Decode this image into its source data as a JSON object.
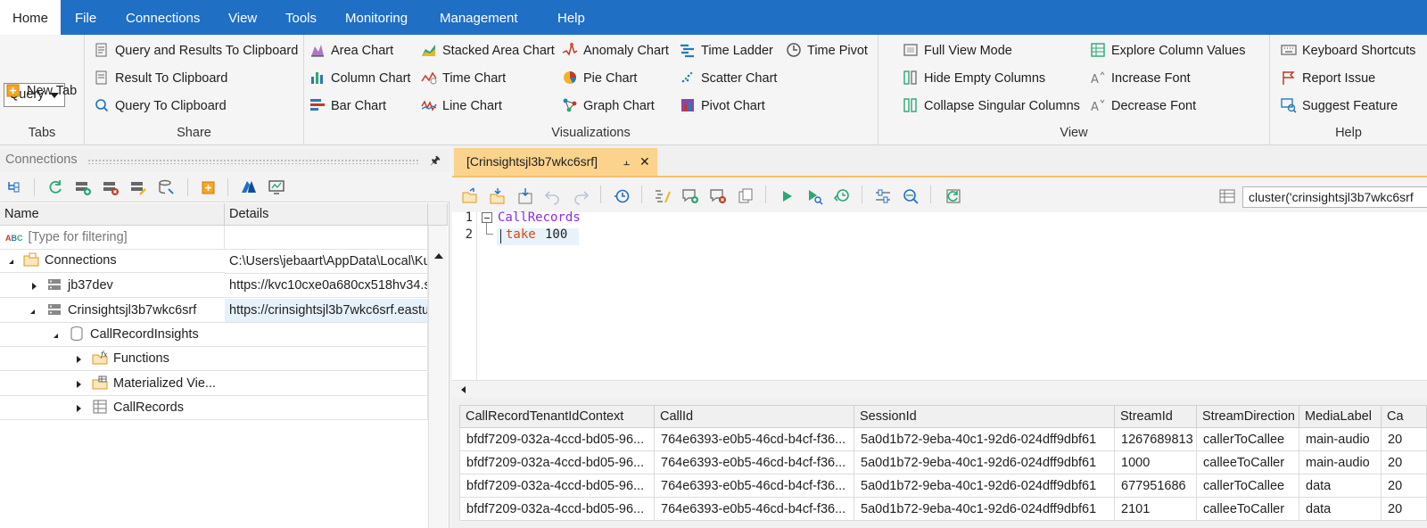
{
  "menu": {
    "items": [
      "Home",
      "File",
      "Connections",
      "View",
      "Tools",
      "Monitoring",
      "Management",
      "Help"
    ]
  },
  "ribbon": {
    "tabs_group": {
      "label": "Tabs",
      "query_combo": "Query",
      "new_tab": "New Tab"
    },
    "share_group": {
      "label": "Share",
      "items": [
        "Query and Results To Clipboard",
        "Result To Clipboard",
        "Query To Clipboard"
      ]
    },
    "viz_group": {
      "label": "Visualizations",
      "items": [
        "Area Chart",
        "Stacked Area Chart",
        "Anomaly Chart",
        "Time Ladder",
        "Time Pivot",
        "Column Chart",
        "Time Chart",
        "Pie Chart",
        "Scatter Chart",
        "Bar Chart",
        "Line Chart",
        "Graph Chart",
        "Pivot Chart"
      ]
    },
    "view_group": {
      "label": "View",
      "items": [
        "Full View Mode",
        "Hide Empty Columns",
        "Collapse Singular Columns",
        "Explore Column Values",
        "Increase Font",
        "Decrease Font"
      ]
    },
    "help_group": {
      "label": "Help",
      "items": [
        "Keyboard Shortcuts",
        "Report Issue",
        "Suggest Feature"
      ]
    }
  },
  "connections": {
    "title": "Connections",
    "columns": [
      "Name",
      "Details"
    ],
    "filter_placeholder": "[Type for filtering]",
    "tree": [
      {
        "label": "Connections",
        "details": "C:\\Users\\jebaart\\AppData\\Local\\Ku"
      },
      {
        "label": "jb37dev",
        "details": "https://kvc10cxe0a680cx518hv34.s"
      },
      {
        "label": "Crinsightsjl3b7wkc6srf",
        "details": "https://crinsightsjl3b7wkc6srf.eastu"
      },
      {
        "label": "CallRecordInsights",
        "details": ""
      },
      {
        "label": "Functions",
        "details": ""
      },
      {
        "label": "Materialized Vie...",
        "details": ""
      },
      {
        "label": "CallRecords",
        "details": ""
      }
    ]
  },
  "editor": {
    "tab_title": "[Crinsightsjl3b7wkc6srf]",
    "cluster": "cluster('crinsightsjl3b7wkc6srf",
    "lines": [
      {
        "num": "1",
        "table": "CallRecords"
      },
      {
        "num": "2",
        "op": "take",
        "arg": "100"
      }
    ]
  },
  "results": {
    "columns": [
      "CallRecordTenantIdContext",
      "CallId",
      "SessionId",
      "StreamId",
      "StreamDirection",
      "MediaLabel",
      "Ca"
    ],
    "rows": [
      [
        "bfdf7209-032a-4ccd-bd05-96...",
        "764e6393-e0b5-46cd-b4cf-f36...",
        "5a0d1b72-9eba-40c1-92d6-024dff9dbf61",
        "1267689813",
        "callerToCallee",
        "main-audio",
        "20"
      ],
      [
        "bfdf7209-032a-4ccd-bd05-96...",
        "764e6393-e0b5-46cd-b4cf-f36...",
        "5a0d1b72-9eba-40c1-92d6-024dff9dbf61",
        "1000",
        "calleeToCaller",
        "main-audio",
        "20"
      ],
      [
        "bfdf7209-032a-4ccd-bd05-96...",
        "764e6393-e0b5-46cd-b4cf-f36...",
        "5a0d1b72-9eba-40c1-92d6-024dff9dbf61",
        "677951686",
        "callerToCallee",
        "data",
        "20"
      ],
      [
        "bfdf7209-032a-4ccd-bd05-96...",
        "764e6393-e0b5-46cd-b4cf-f36...",
        "5a0d1b72-9eba-40c1-92d6-024dff9dbf61",
        "2101",
        "calleeToCaller",
        "data",
        "20"
      ]
    ]
  },
  "colors": {
    "menubar": "#1f6fc5",
    "tab_active": "#fbd38d",
    "keyword": "#d9480f",
    "table_name": "#8a2be2",
    "selected_row": "#e5f1fb"
  }
}
